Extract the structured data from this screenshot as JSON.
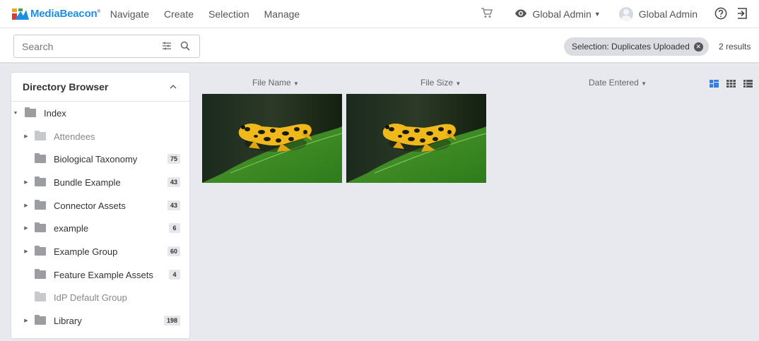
{
  "header": {
    "logo_text": "MediaBeacon",
    "logo_mark": "®",
    "nav": [
      "Navigate",
      "Create",
      "Selection",
      "Manage"
    ],
    "view_as": "Global Admin",
    "user_name": "Global Admin",
    "icons": [
      "cart-icon",
      "eye-icon",
      "help-icon",
      "logout-icon"
    ]
  },
  "search": {
    "placeholder": "Search",
    "selection_chip": "Selection: Duplicates Uploaded",
    "results": "2 results"
  },
  "directory": {
    "title": "Directory Browser",
    "items": [
      {
        "label": "Index",
        "count": ""
      },
      {
        "label": "Attendees",
        "count": ""
      },
      {
        "label": "Biological Taxonomy",
        "count": "75"
      },
      {
        "label": "Bundle Example",
        "count": "43"
      },
      {
        "label": "Connector Assets",
        "count": "43"
      },
      {
        "label": "example",
        "count": "6"
      },
      {
        "label": "Example Group",
        "count": "60"
      },
      {
        "label": "Feature Example Assets",
        "count": "4"
      },
      {
        "label": "IdP Default Group",
        "count": ""
      },
      {
        "label": "Library",
        "count": "198"
      }
    ]
  },
  "columns": {
    "file_name": "File Name",
    "file_size": "File Size",
    "date_entered": "Date Entered"
  },
  "colors": {
    "accent": "#1e8fe0",
    "active_view": "#3b7ddd"
  }
}
